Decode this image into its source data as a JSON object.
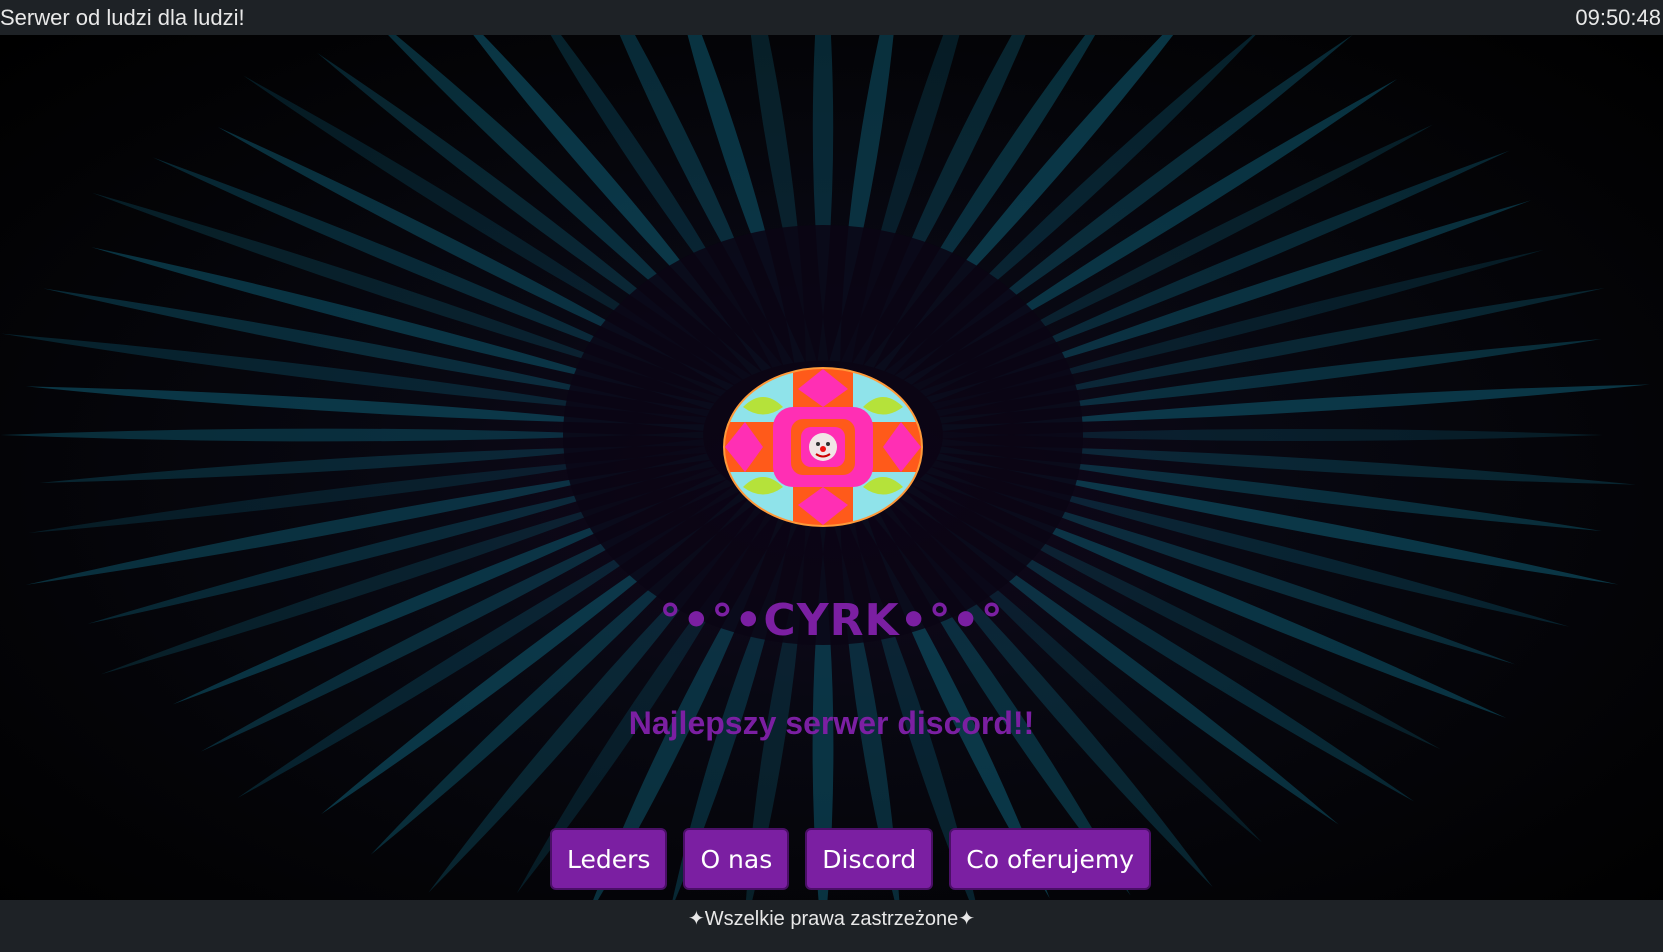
{
  "header": {
    "title": "Serwer od ludzi dla ludzi!",
    "clock": "09:50:48"
  },
  "hero": {
    "brand": "°•°•CYRK•°•°",
    "tagline": "Najlepszy serwer discord!!",
    "logo_icon": "clown-kaleidoscope-logo"
  },
  "nav": {
    "items": [
      "Leders",
      "O nas",
      "Discord",
      "Co oferujemy"
    ]
  },
  "footer": {
    "text": "✦Wszelkie prawa zastrzeżone✦"
  },
  "colors": {
    "accent": "#7b1fa2",
    "bar_bg": "#1e2226",
    "burst": "#0c4a5e"
  }
}
